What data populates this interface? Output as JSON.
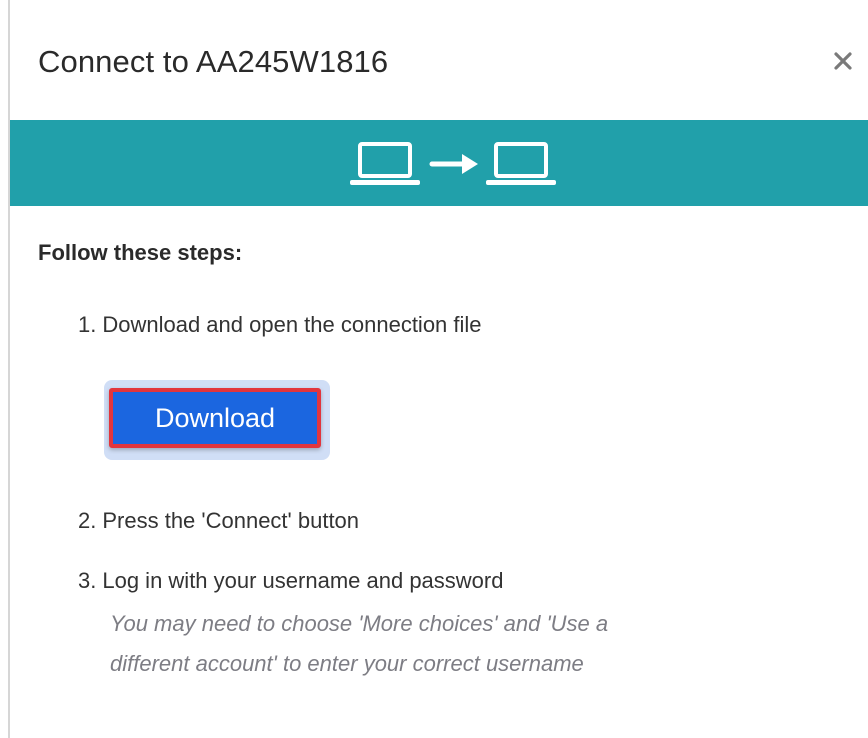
{
  "dialog": {
    "title": "Connect to AA245W1816",
    "close_symbol": "×",
    "banner_color": "#21a0aa"
  },
  "steps": {
    "heading": "Follow these steps:",
    "items": [
      {
        "number": "1.",
        "text": "Download and open the connection file"
      },
      {
        "number": "2.",
        "text": "Press the 'Connect' button"
      },
      {
        "number": "3.",
        "text": "Log in with your username and password"
      }
    ],
    "note_lines": [
      "You may need to choose 'More choices' and 'Use a",
      "different account' to enter your correct username"
    ]
  },
  "download": {
    "label": "Download",
    "button_color": "#1b66e0",
    "highlight_color": "#e2353d"
  },
  "icons": {
    "banner_left": "laptop-icon",
    "banner_middle": "arrow-right-icon",
    "banner_right": "laptop-icon",
    "close": "close-icon"
  }
}
